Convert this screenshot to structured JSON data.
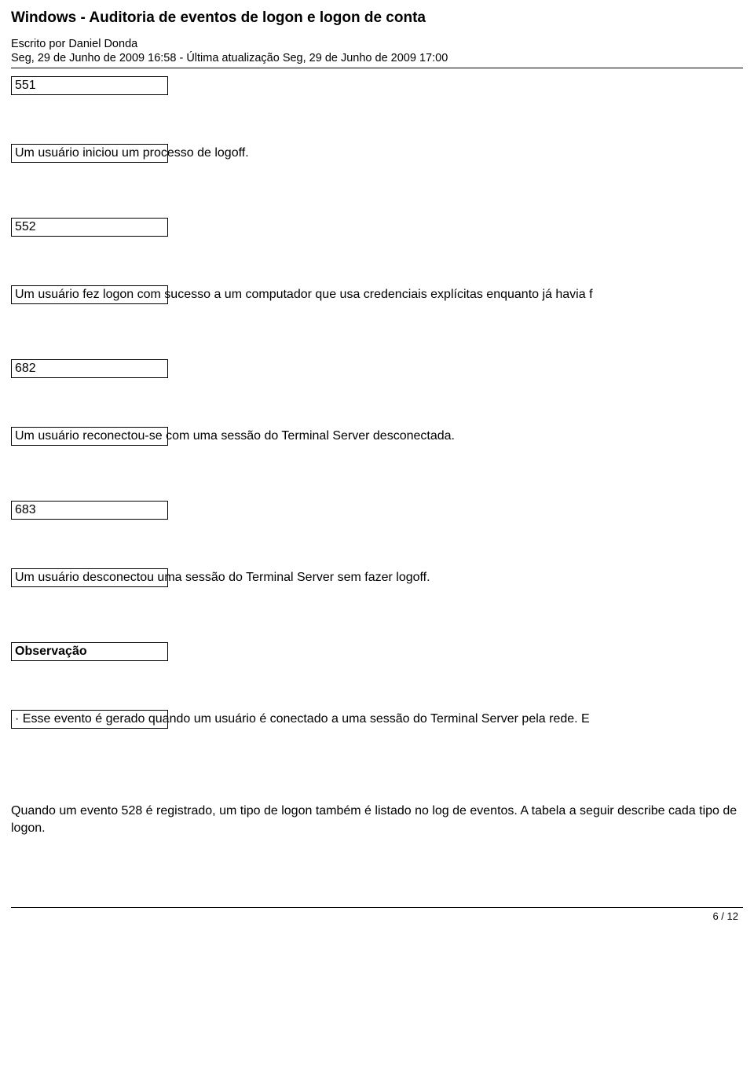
{
  "header": {
    "title": "Windows - Auditoria de eventos de logon e logon de conta",
    "author_line": "Escrito por Daniel Donda",
    "date_line": "Seg, 29 de Junho de 2009 16:58 - Última atualização Seg, 29 de Junho de 2009 17:00"
  },
  "rows": [
    {
      "id": "551",
      "text": "Um usuário iniciou um processo de logoff."
    },
    {
      "id": "552",
      "text": "Um usuário fez logon com sucesso a um computador que usa credenciais explícitas enquanto já havia f"
    },
    {
      "id": "682",
      "text": "Um usuário reconectou-se com uma sessão do Terminal Server desconectada."
    },
    {
      "id": "683",
      "text": "Um usuário desconectou uma sessão do Terminal Server sem fazer logoff."
    },
    {
      "id": "Observação",
      "bold": true,
      "text": "· Esse evento é gerado quando um usuário é conectado a uma sessão do Terminal Server pela rede. E"
    }
  ],
  "paragraph": "Quando um evento 528 é registrado, um tipo de logon também é listado no log de eventos. A tabela a seguir describe cada tipo de logon.",
  "footer": {
    "page": "6 / 12"
  }
}
